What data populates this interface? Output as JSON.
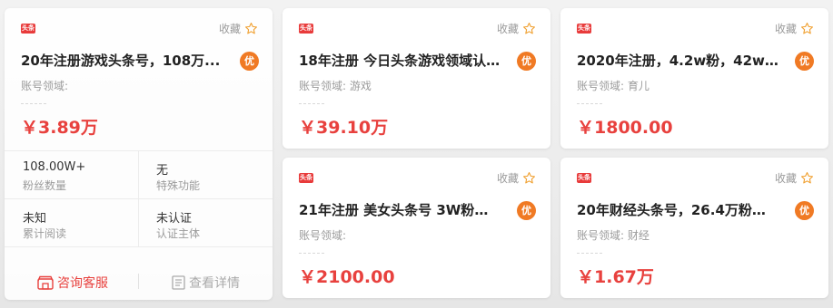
{
  "favorite_label": "收藏",
  "badge_label": "优",
  "logo_text": "头条",
  "domain_prefix": "账号领域:",
  "cards": [
    {
      "title": "20年注册游戏头条号，108万...",
      "domain": "",
      "price": "￥3.89万",
      "stats": [
        {
          "value": "108.00W+",
          "label": "粉丝数量"
        },
        {
          "value": "无",
          "label": "特殊功能"
        },
        {
          "value": "未知",
          "label": "累计阅读"
        },
        {
          "value": "未认证",
          "label": "认证主体"
        }
      ],
      "actions": {
        "consult": "咨询客服",
        "detail": "查看详情"
      }
    },
    {
      "title": "18年注册 今日头条游戏领域认...",
      "domain": "游戏",
      "price": "￥39.10万"
    },
    {
      "title": "2020年注册，4.2w粉，42w赞...",
      "domain": "育儿",
      "price": "￥1800.00"
    },
    {
      "title": "21年注册 美女头条号 3W粉丝 ...",
      "domain": "",
      "price": "￥2100.00"
    },
    {
      "title": "20年财经头条号，26.4万粉，3...",
      "domain": "财经",
      "price": "￥1.67万"
    }
  ],
  "colors": {
    "accent": "#e8413e",
    "badge": "#f07a24",
    "logo": "#e83b3b"
  },
  "icons": [
    "toutiao-logo-icon",
    "star-icon",
    "customer-service-icon",
    "detail-doc-icon"
  ]
}
